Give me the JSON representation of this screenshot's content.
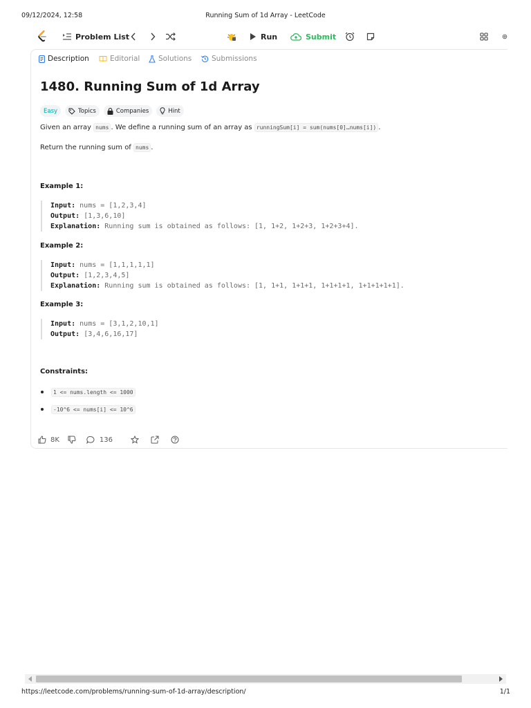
{
  "print_header": {
    "datetime": "09/12/2024, 12:58",
    "page_title": "Running Sum of 1d Array - LeetCode"
  },
  "toolbar": {
    "problem_list": "Problem List",
    "run": "Run",
    "submit": "Submit"
  },
  "tabs": [
    {
      "label": "Description"
    },
    {
      "label": "Editorial"
    },
    {
      "label": "Solutions"
    },
    {
      "label": "Submissions"
    }
  ],
  "problem": {
    "title": "1480. Running Sum of 1d Array",
    "difficulty": "Easy",
    "topics": "Topics",
    "companies": "Companies",
    "hint": "Hint",
    "desc_p1_a": "Given an array ",
    "desc_p1_code1": "nums",
    "desc_p1_b": ". We define a running sum of an array as ",
    "desc_p1_code2": "runningSum[i] = sum(nums[0]…nums[i])",
    "desc_p1_c": ".",
    "desc_p2_a": "Return the running sum of ",
    "desc_p2_code": "nums",
    "desc_p2_b": "."
  },
  "examples": [
    {
      "heading": "Example 1:",
      "input_label": "Input:",
      "input": "nums = [1,2,3,4]",
      "output_label": "Output:",
      "output": "[1,3,6,10]",
      "explanation_label": "Explanation:",
      "explanation": "Running sum is obtained as follows: [1, 1+2, 1+2+3, 1+2+3+4]."
    },
    {
      "heading": "Example 2:",
      "input_label": "Input:",
      "input": "nums = [1,1,1,1,1]",
      "output_label": "Output:",
      "output": "[1,2,3,4,5]",
      "explanation_label": "Explanation:",
      "explanation": "Running sum is obtained as follows: [1, 1+1, 1+1+1, 1+1+1+1, 1+1+1+1+1]."
    },
    {
      "heading": "Example 3:",
      "input_label": "Input:",
      "input": "nums = [3,1,2,10,1]",
      "output_label": "Output:",
      "output": "[3,4,6,16,17]"
    }
  ],
  "constraints": {
    "heading": "Constraints:",
    "items": [
      "1 <= nums.length <= 1000",
      "-10^6 <= nums[i] <= 10^6"
    ]
  },
  "footer": {
    "likes": "8K",
    "comments": "136"
  },
  "print_footer": {
    "url": "https://leetcode.com/problems/running-sum-of-1d-array/description/",
    "page": "1/1"
  },
  "colors": {
    "submit_green": "#2cbb5d",
    "easy_teal": "#00a8a8",
    "logo_orange": "#ffa116"
  }
}
